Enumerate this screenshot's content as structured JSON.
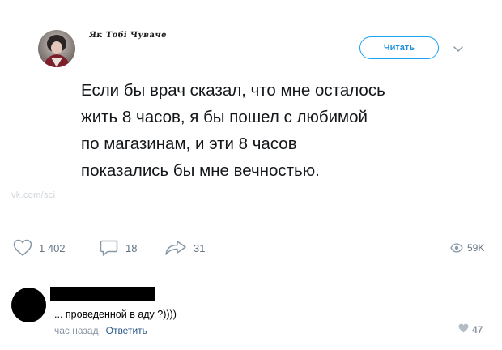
{
  "tweet": {
    "author_name": "Як Тобі Чуваче",
    "follow_label": "Читать",
    "text": "Если бы врач сказал, что мне осталось\nжить 8 часов, я бы пошел с любимой\nпо магазинам, и эти 8 часов\nпоказались бы мне вечностью.",
    "watermark": "vk.com/sci",
    "likes": "1 402",
    "replies": "18",
    "retweets": "31",
    "views": "59K"
  },
  "comment": {
    "text": "... проведенной в аду ?))))",
    "time": "час назад",
    "reply_label": "Ответить",
    "likes": "47"
  },
  "colors": {
    "accent": "#1da1f2",
    "icon_gray": "#8899a6",
    "vk_link": "#2a5885"
  }
}
